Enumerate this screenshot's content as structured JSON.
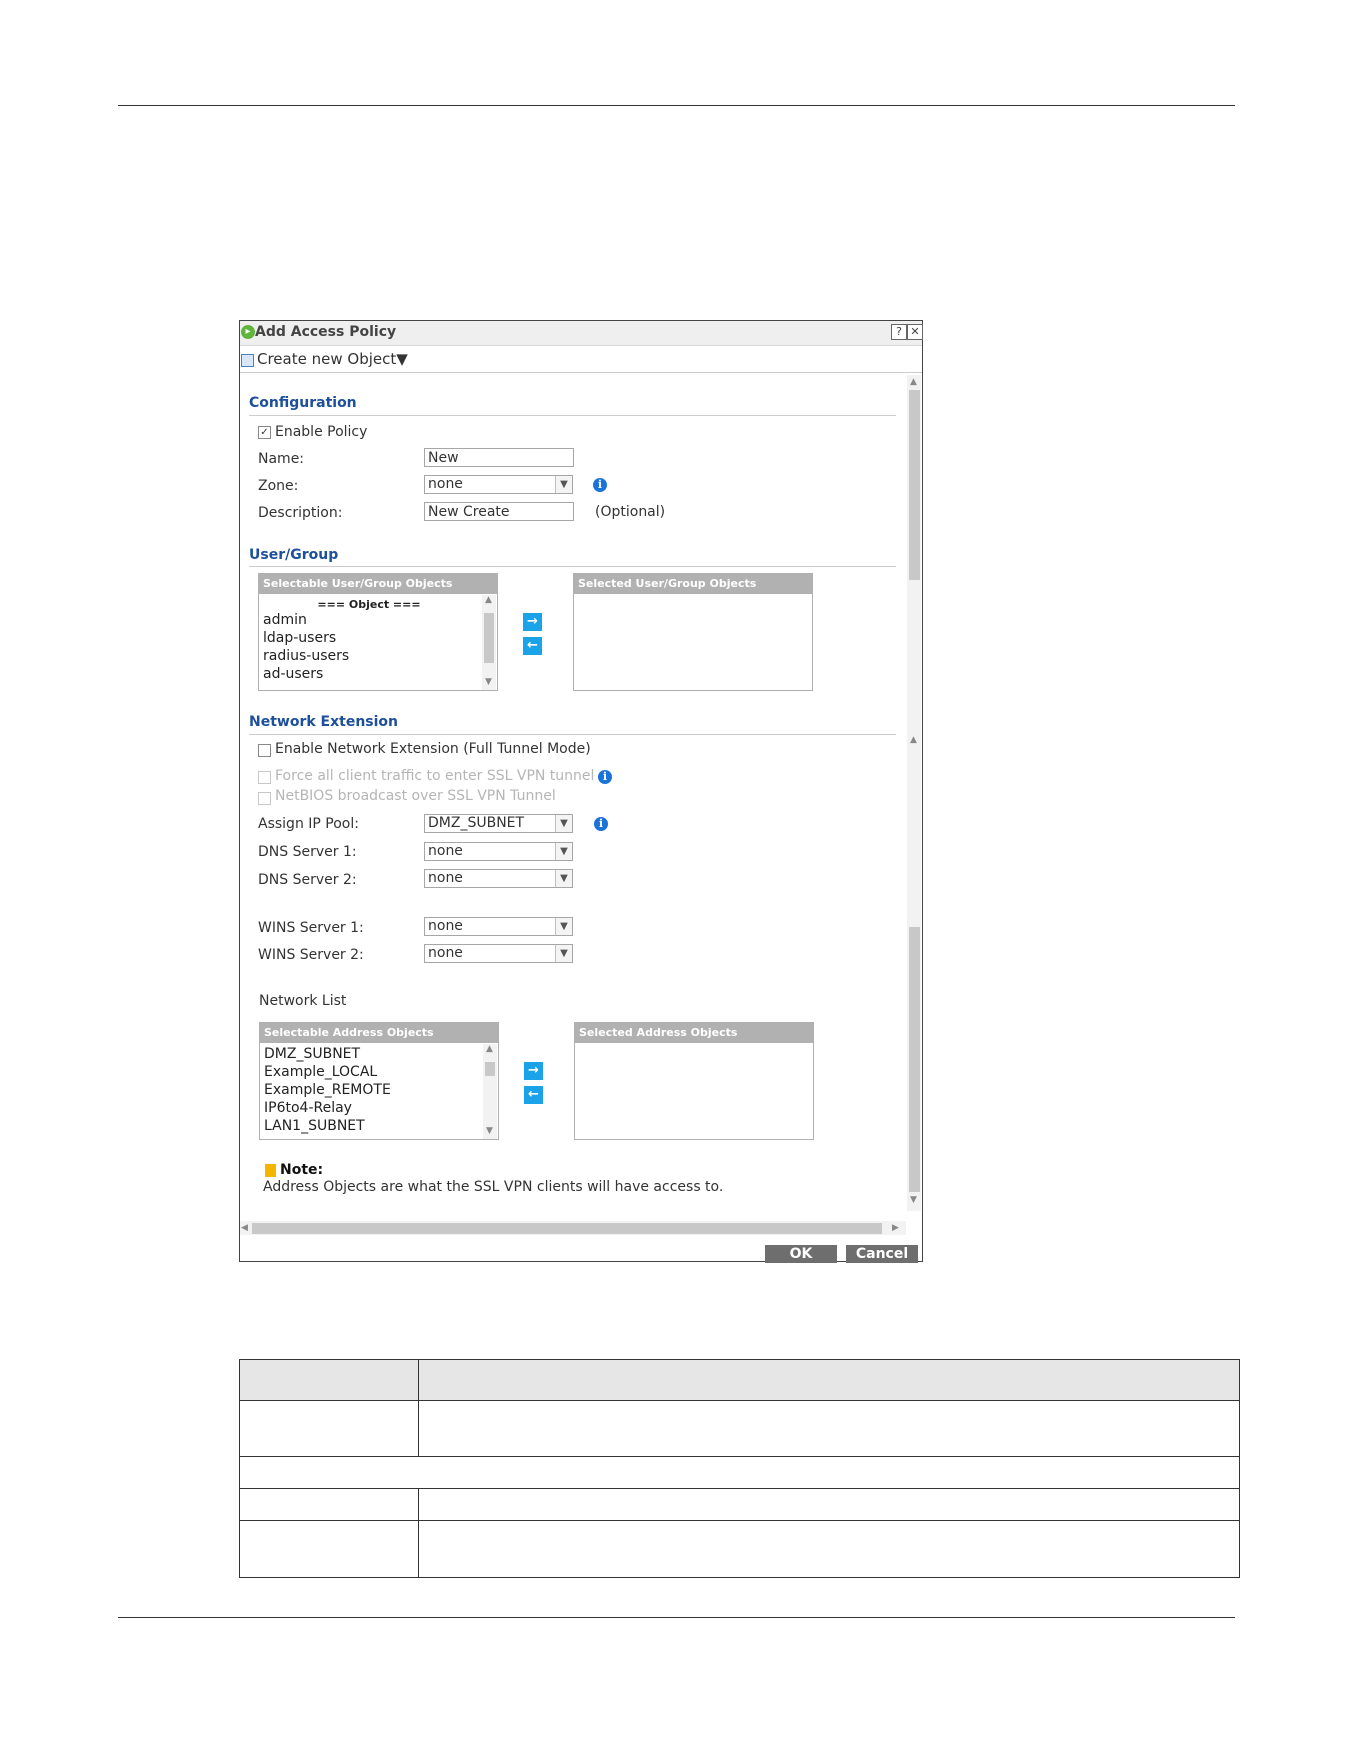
{
  "dialog": {
    "title": "Add Access Policy",
    "help_glyph": "?",
    "close_glyph": "✕",
    "toolbar": {
      "create_object_label": "Create new Object▼"
    }
  },
  "configuration": {
    "section_title": "Configuration",
    "enable_policy_label": "Enable Policy",
    "enable_policy_checked": true,
    "name_label": "Name:",
    "name_value": "New",
    "zone_label": "Zone:",
    "zone_value": "none",
    "description_label": "Description:",
    "description_value": "New Create",
    "optional_label": "(Optional)"
  },
  "user_group": {
    "section_title": "User/Group",
    "selectable_header": "Selectable User/Group Objects",
    "selected_header": "Selected User/Group Objects",
    "group_heading": "=== Object ===",
    "items": [
      "admin",
      "ldap-users",
      "radius-users",
      "ad-users"
    ]
  },
  "network_extension": {
    "section_title": "Network Extension",
    "enable_label": "Enable Network Extension (Full Tunnel Mode)",
    "force_label": "Force all client traffic to enter SSL VPN tunnel",
    "netbios_label": "NetBIOS broadcast over SSL VPN Tunnel",
    "assign_ip_pool_label": "Assign IP Pool:",
    "assign_ip_pool_value": "DMZ_SUBNET",
    "dns1_label": "DNS Server 1:",
    "dns1_value": "none",
    "dns2_label": "DNS Server 2:",
    "dns2_value": "none",
    "wins1_label": "WINS Server 1:",
    "wins1_value": "none",
    "wins2_label": "WINS Server 2:",
    "wins2_value": "none",
    "network_list_label": "Network List",
    "selectable_header": "Selectable Address Objects",
    "selected_header": "Selected Address Objects",
    "items": [
      "DMZ_SUBNET",
      "Example_LOCAL",
      "Example_REMOTE",
      "IP6to4-Relay",
      "LAN1_SUBNET"
    ]
  },
  "note": {
    "title": "Note:",
    "text": "Address Objects are what the SSL VPN clients will have access to."
  },
  "footer": {
    "ok_label": "OK",
    "cancel_label": "Cancel"
  },
  "colors": {
    "section_title": "#1d4f9a",
    "arrow_button": "#1aa3e8",
    "info_icon": "#1a73d9",
    "footer_button": "#6e6e6e"
  }
}
